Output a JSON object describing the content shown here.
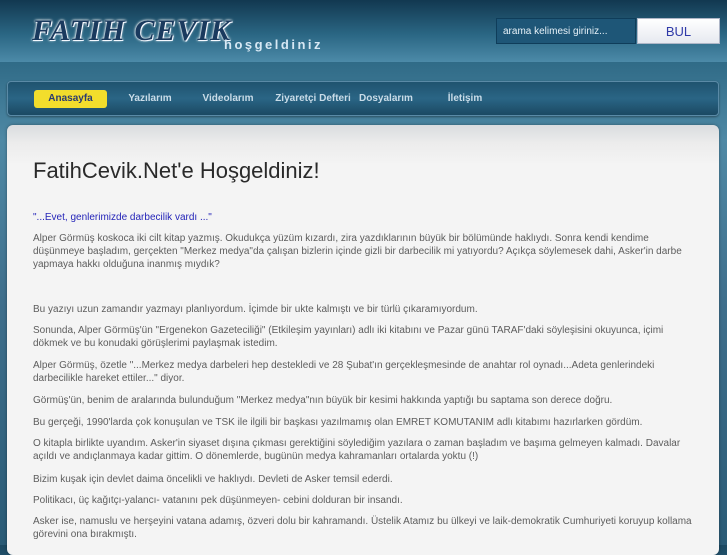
{
  "header": {
    "logo": "FATIH CEVIK",
    "welcome": "hoşgeldiniz",
    "search_placeholder": "arama kelimesi giriniz...",
    "search_button": "BUL"
  },
  "nav": {
    "items": [
      {
        "label": "Anasayfa",
        "active": true
      },
      {
        "label": "Yazılarım"
      },
      {
        "label": "Videolarım"
      },
      {
        "label": "Ziyaretçi Defteri"
      },
      {
        "label": "Dosyalarım"
      },
      {
        "label": "İletişim"
      }
    ]
  },
  "content": {
    "title": "FatihCevik.Net'e Hoşgeldiniz!",
    "quote": "\"...Evet, genlerimizde darbecilik vardı ...\"",
    "paragraphs": [
      "Alper Görmüş koskoca iki cilt kitap yazmış. Okudukça yüzüm kızardı, zira yazdıklarının büyük bir bölümünde haklıydı. Sonra kendi kendime düşünmeye başladım, gerçekten \"Merkez medya\"da çalışan bizlerin içinde gizli bir darbecilik mi yatıyordu? Açıkça söylemesek dahi, Asker'in darbe yapmaya hakkı olduğuna inanmış mıydık?",
      "Bu yazıyı uzun zamandır yazmayı planlıyordum. İçimde bir ukte kalmıştı ve bir türlü çıkaramıyordum.",
      "Sonunda, Alper Görmüş'ün \"Ergenekon Gazeteciliği\" (Etkileşim yayınları)  adlı iki kitabını ve Pazar günü TARAF'daki söyleşisini okuyunca, içimi dökmek ve bu konudaki görüşlerimi paylaşmak istedim.",
      "Alper Görmüş, özetle \"...Merkez medya darbeleri hep destekledi ve 28 Şubat'ın gerçekleşmesinde de anahtar rol oynadı...Adeta genlerindeki darbecilikle hareket ettiler...\"  diyor.",
      "Görmüş'ün, benim de aralarında bulunduğum  \"Merkez medya\"nın büyük bir kesimi hakkında yaptığı bu saptama son derece doğru.",
      "Bu gerçeği, 1990'larda çok konuşulan ve TSK ile ilgili bir başkası yazılmamış olan EMRET KOMUTANIM adlı kitabımı hazırlarken gördüm.",
      "O kitapla birlikte uyandım. Asker'in siyaset dışına çıkması gerektiğini söylediğim yazılara o zaman başladım ve başıma gelmeyen kalmadı. Davalar açıldı ve andıçlanmaya kadar gittim. O dönemlerde, bugünün medya kahramanları ortalarda yoktu (!)",
      "Bizim kuşak  için devlet daima öncelikli ve haklıydı. Devleti de Asker temsil ederdi.",
      "Politikacı, üç kağıtçı-yalancı- vatanını pek düşünmeyen- cebini dolduran bir insandı.",
      "Asker ise, namuslu ve herşeyini vatana adamış, özveri dolu bir kahramandı. Üstelik Atamız bu ülkeyi ve laik-demokratik Cumhuriyeti  koruyup kollama görevini ona bırakmıştı."
    ]
  }
}
